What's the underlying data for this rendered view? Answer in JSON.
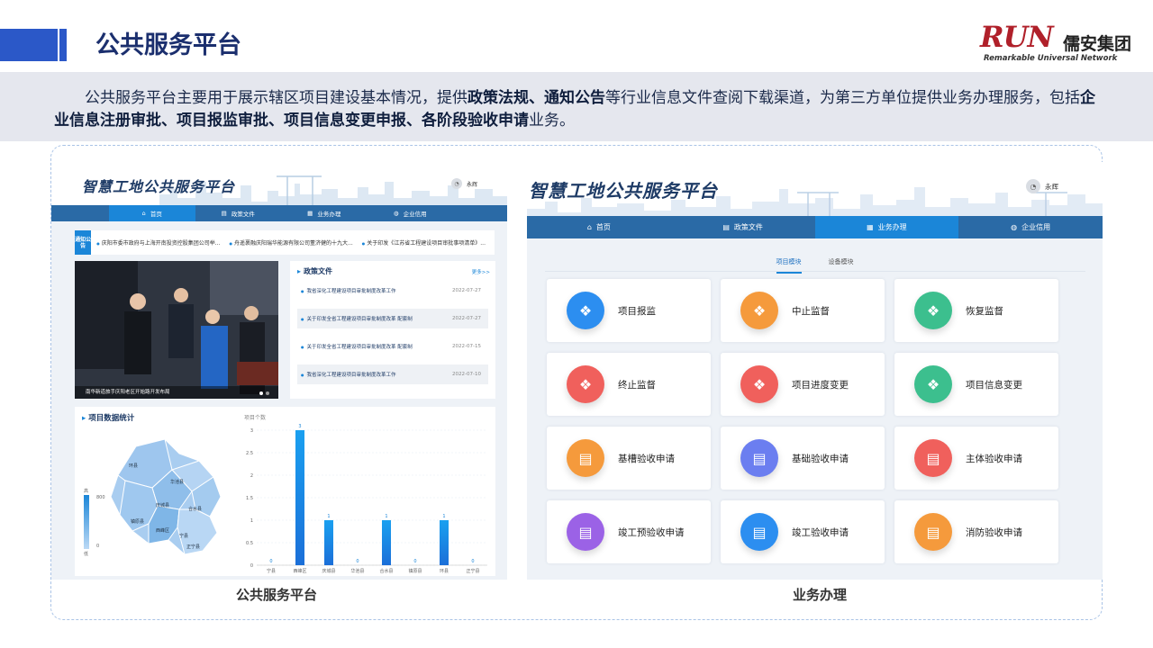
{
  "slide": {
    "title": "公共服务平台",
    "logo": {
      "brand": "RUN",
      "company": "儒安集团",
      "tagline": "Remarkable Universal Network"
    },
    "description": {
      "p1": "公共服务平台主要用于展示辖区项目建设基本情况，提供",
      "b1": "政策法规、通知公告",
      "p2": "等行业信息文件查阅下载渠道，为第三方单位提供业务办理服务，包括",
      "b2": "企业信息注册审批、项目报监审批、项目信息变更申报、各阶段验收申请",
      "p3": "业务。"
    },
    "caption_left": "公共服务平台",
    "caption_right": "业务办理"
  },
  "left_screen": {
    "brand": "智慧工地公共服务平台",
    "user": "永辉",
    "nav": [
      "首页",
      "政策文件",
      "业务办理",
      "企业信用"
    ],
    "notice_badge": "通知公告",
    "notices": [
      "庆阳市委市政府与上海开南投资控股集团公司举...",
      "舟遥裹融庆阳瑞华能源有限公司董济健的十九大...",
      "关于印发《江苏省工程建设项目审批事项清单》..."
    ],
    "photo_caption": "南华新道旅手庆阳老区开始路开发布局",
    "policy": {
      "title": "政策文件",
      "more": "更多>>",
      "items": [
        {
          "text": "我省深化工程建设项目审批制度改革工作",
          "date": "2022-07-27"
        },
        {
          "text": "关于印发全省工程建设项目审批制度改革 配套制",
          "date": "2022-07-27"
        },
        {
          "text": "关于印发全省工程建设项目审批制度改革 配套制",
          "date": "2022-07-15"
        },
        {
          "text": "我省深化工程建设项目审批制度改革工作",
          "date": "2022-07-10"
        }
      ]
    },
    "stats": {
      "title": "项目数据统计",
      "legend_high": "高",
      "legend_low": "低",
      "legend_max": "800",
      "legend_min": "0",
      "map_labels": [
        "环县",
        "华池县",
        "庆城县",
        "合水县",
        "镇原县",
        "西峰区",
        "宁县",
        "正宁县"
      ]
    }
  },
  "chart_data": {
    "type": "bar",
    "title": "",
    "ylabel": "项目个数",
    "xlabel": "",
    "categories": [
      "宁县",
      "西峰区",
      "庆城县",
      "华池县",
      "合水县",
      "镇原县",
      "环县",
      "正宁县"
    ],
    "values": [
      0,
      3,
      1,
      0,
      1,
      0,
      1,
      0
    ],
    "ylim": [
      0,
      3
    ],
    "yticks": [
      "0",
      "0.5",
      "1",
      "1.5",
      "2",
      "2.5",
      "3"
    ],
    "grid": true
  },
  "right_screen": {
    "brand": "智慧工地公共服务平台",
    "user": "永辉",
    "nav": [
      "首页",
      "政策文件",
      "业务办理",
      "企业信用"
    ],
    "tabs": [
      "项目模块",
      "设备模块"
    ],
    "cards": [
      {
        "label": "项目报监",
        "color": "#2c8ef0"
      },
      {
        "label": "中止监督",
        "color": "#f59a3c"
      },
      {
        "label": "恢复监督",
        "color": "#3cbf8e"
      },
      {
        "label": "终止监督",
        "color": "#f0605c"
      },
      {
        "label": "项目进度变更",
        "color": "#f0605c"
      },
      {
        "label": "项目信息变更",
        "color": "#3cbf8e"
      },
      {
        "label": "基槽验收申请",
        "color": "#f59a3c"
      },
      {
        "label": "基础验收申请",
        "color": "#6b7ef0"
      },
      {
        "label": "主体验收申请",
        "color": "#f0605c"
      },
      {
        "label": "竣工预验收申请",
        "color": "#9b62e6"
      },
      {
        "label": "竣工验收申请",
        "color": "#2c8ef0"
      },
      {
        "label": "消防验收申请",
        "color": "#f59a3c"
      }
    ]
  }
}
